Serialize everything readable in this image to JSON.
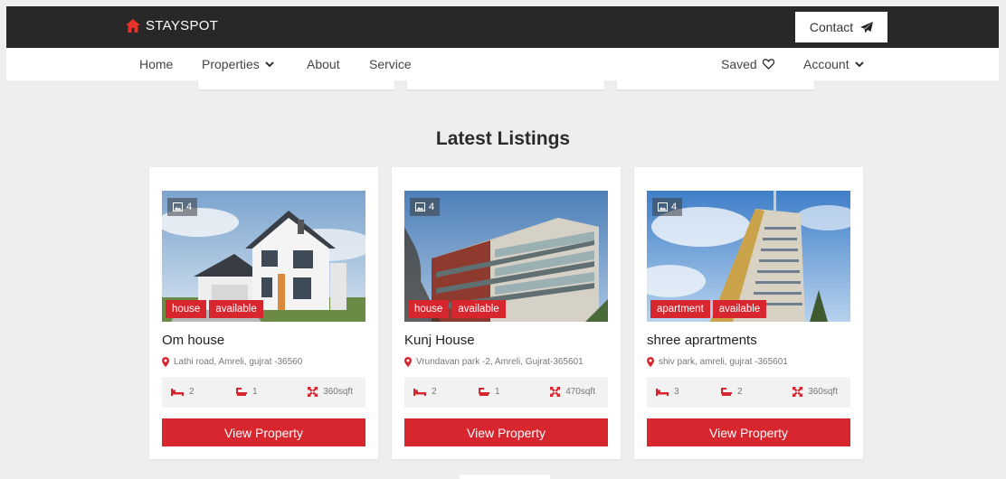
{
  "brand": {
    "name": "STAYSPOT"
  },
  "header": {
    "contact_label": "Contact"
  },
  "nav": {
    "home": "Home",
    "properties": "Properties",
    "about": "About",
    "service": "Service",
    "saved": "Saved",
    "account": "Account"
  },
  "section": {
    "title": "Latest Listings"
  },
  "colors": {
    "accent": "#d8262e",
    "topbar": "#282828",
    "background": "#eeeeee"
  },
  "listings": [
    {
      "image_count": "4",
      "type": "house",
      "status": "available",
      "title": "Om house",
      "address": "Lathi road, Amreli, gujrat -36560",
      "beds": "2",
      "baths": "1",
      "area": "360sqft",
      "button_label": "View Property"
    },
    {
      "image_count": "4",
      "type": "house",
      "status": "available",
      "title": "Kunj House",
      "address": "Vrundavan park -2, Amreli, Gujrat-365601",
      "beds": "2",
      "baths": "1",
      "area": "470sqft",
      "button_label": "View Property"
    },
    {
      "image_count": "4",
      "type": "apartment",
      "status": "available",
      "title": "shree aprartments",
      "address": "shiv park, amreli, gujrat -365601",
      "beds": "3",
      "baths": "2",
      "area": "360sqft",
      "button_label": "View Property"
    }
  ]
}
